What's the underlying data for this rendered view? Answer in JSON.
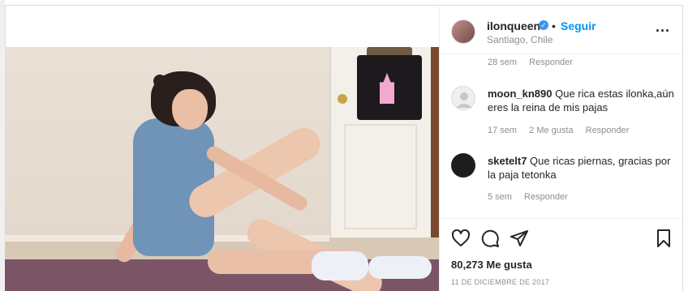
{
  "post": {
    "username": "ilonqueen",
    "verified_mark": "✓",
    "separator": "•",
    "follow_label": "Seguir",
    "location": "Santiago, Chile",
    "more_label": "..."
  },
  "comments": [
    {
      "user": "",
      "text": "",
      "time": "28 sem",
      "likes": "",
      "reply": "Responder"
    },
    {
      "user": "moon_kn890",
      "text": "Que rica estas ilonka,aún eres la reina de mis pajas",
      "time": "17 sem",
      "likes": "2 Me gusta",
      "reply": "Responder"
    },
    {
      "user": "sketelt7",
      "text": "Que ricas piernas, gracias por la paja tetonka",
      "time": "5 sem",
      "likes": "",
      "reply": "Responder"
    }
  ],
  "stats": {
    "likes": "80,273 Me gusta",
    "date": "11 DE DICIEMBRE DE 2017"
  },
  "icons": {
    "like": "heart-icon",
    "comment": "comment-bubble-icon",
    "share": "paper-plane-icon",
    "save": "bookmark-icon"
  },
  "colors": {
    "link": "#0095f6",
    "text": "#262626",
    "muted": "#8e8e8e",
    "verified": "#3897f0"
  }
}
